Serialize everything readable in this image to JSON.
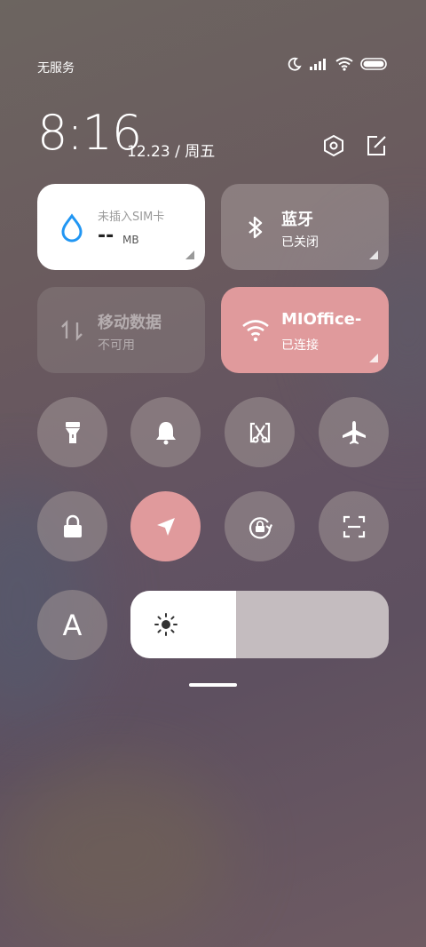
{
  "status": {
    "carrier": "无服务"
  },
  "header": {
    "time": "8:16",
    "date": "12.23 / 周五"
  },
  "tiles": {
    "sim": {
      "title": "未插入SIM卡",
      "value": "--",
      "unit": "MB"
    },
    "bluetooth": {
      "title": "蓝牙",
      "status": "已关闭"
    },
    "mobile": {
      "title": "移动数据",
      "status": "不可用"
    },
    "wifi": {
      "title": "MIOffice-",
      "status": "已连接"
    }
  },
  "toggles": {
    "flashlight": "flashlight-icon",
    "bell": "bell-icon",
    "screenshot": "screenshot-icon",
    "airplane": "airplane-icon",
    "lock": "lock-icon",
    "location": "location-icon",
    "rotation": "rotation-lock-icon",
    "scanner": "scanner-icon",
    "font": "A"
  },
  "brightness": {
    "level": 0.41
  },
  "colors": {
    "active_tile": "#e09a9c",
    "sim_tile": "#ffffff",
    "sim_icon": "#2196f3"
  }
}
